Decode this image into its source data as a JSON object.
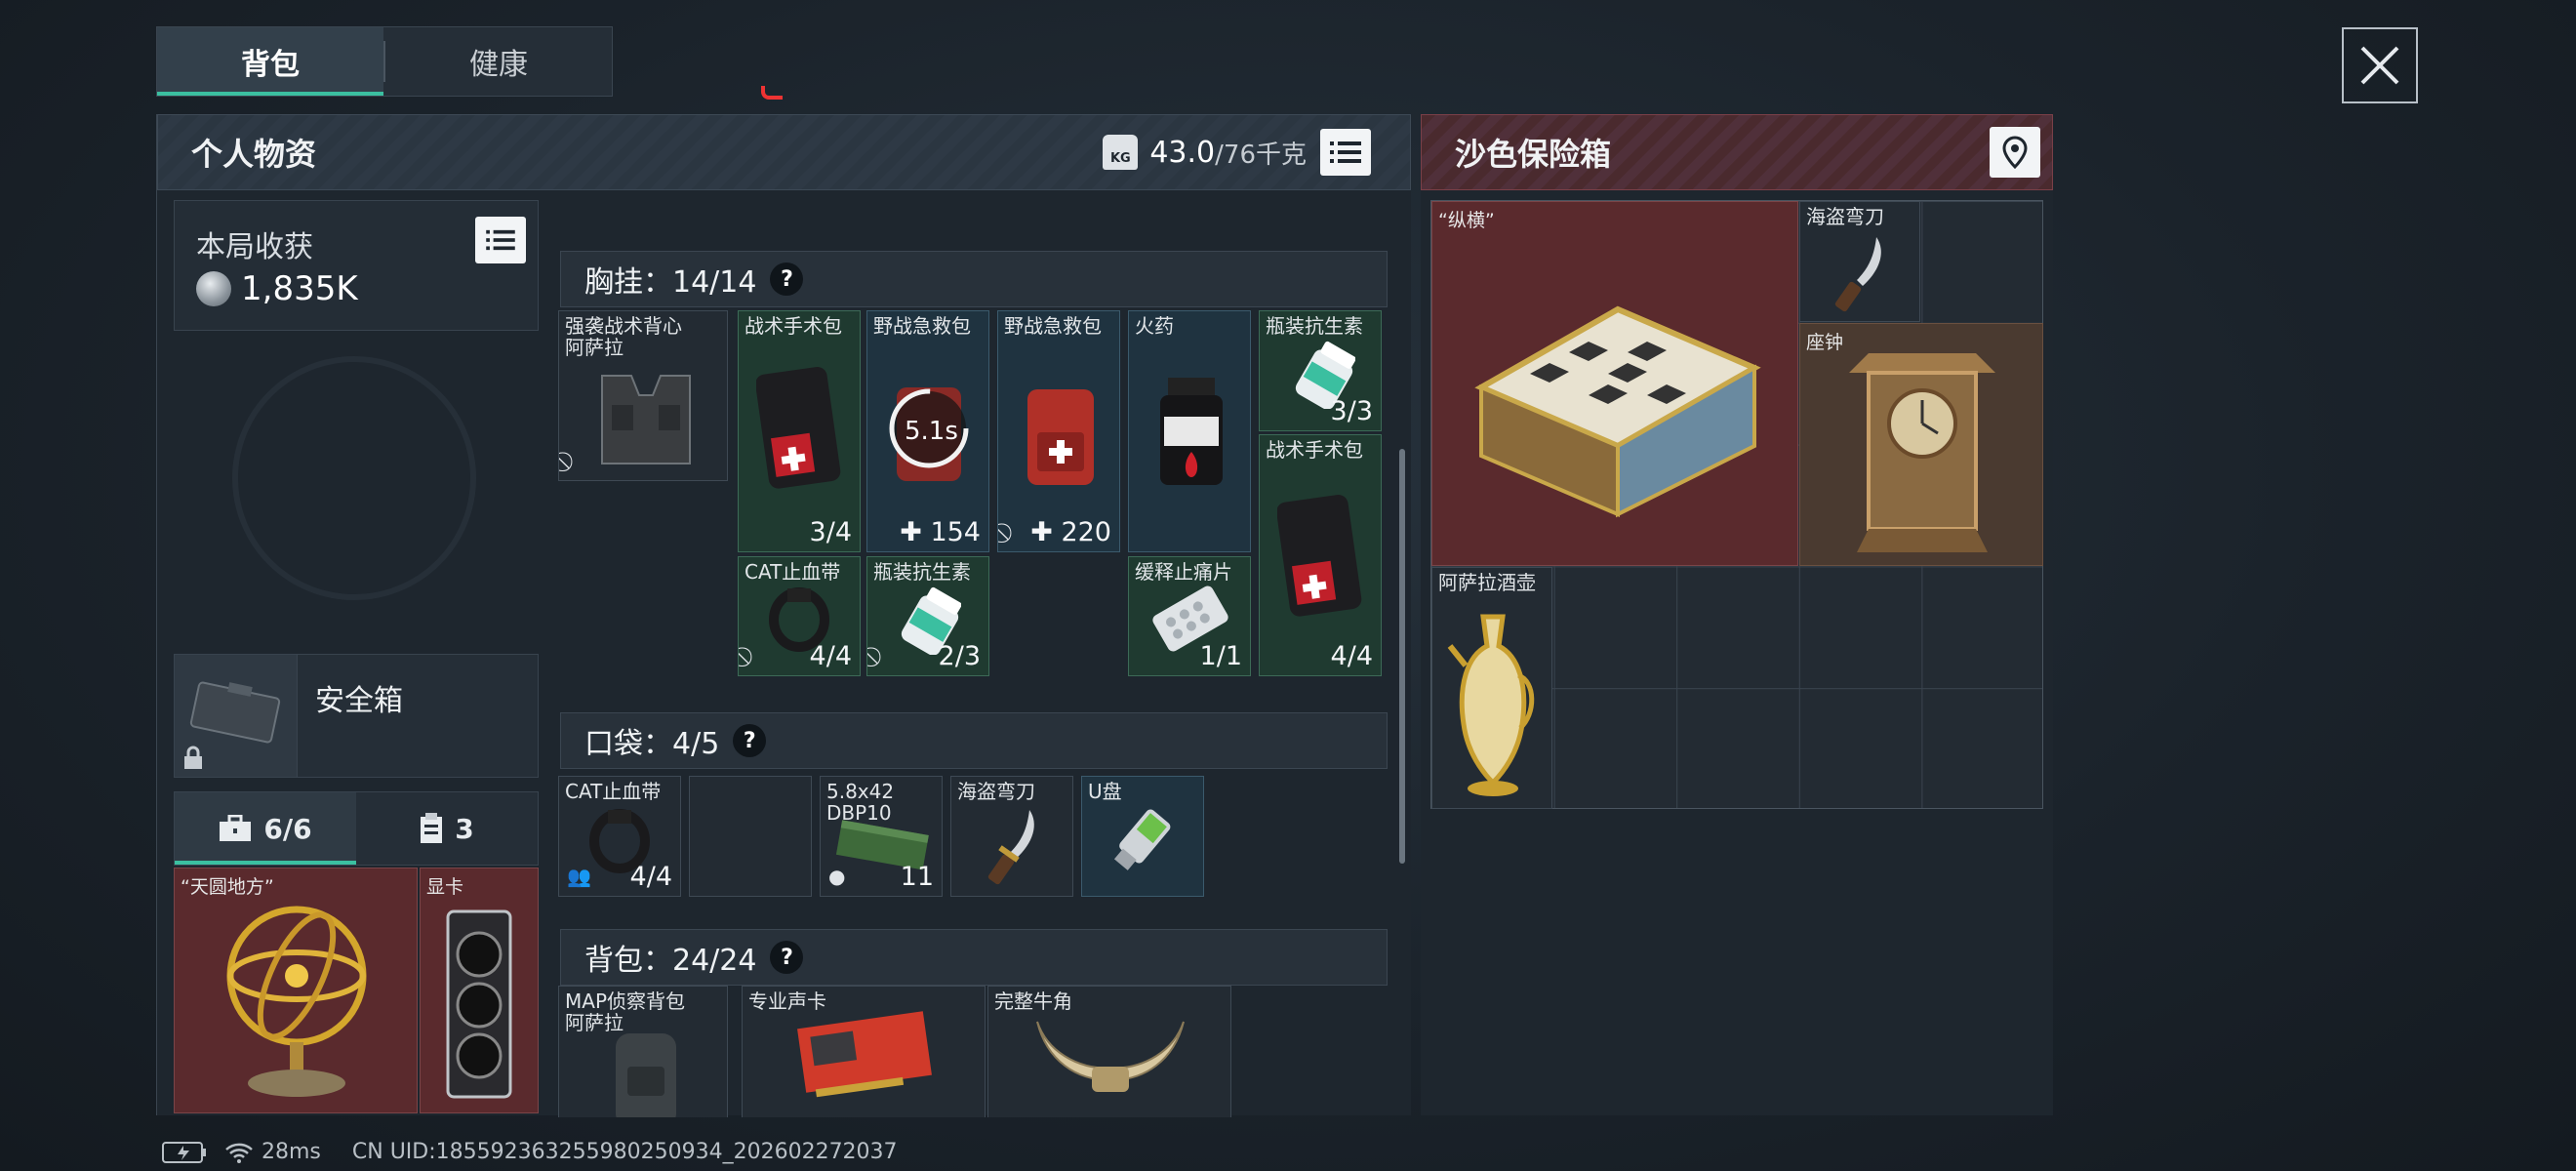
{
  "tabs": [
    {
      "label": "背包",
      "active": true
    },
    {
      "label": "健康",
      "active": false
    }
  ],
  "personal": {
    "title": "个人物资",
    "weight": "43.0",
    "weight_max": "/76千克"
  },
  "harvest": {
    "title": "本局收获",
    "value": "1,835K"
  },
  "safe_box": {
    "label": "安全箱"
  },
  "subtabs": [
    {
      "label": "6/6",
      "icon": "briefcase-icon"
    },
    {
      "label": "3",
      "icon": "clipboard-icon"
    }
  ],
  "safe_items": [
    {
      "name": "“天圆地方”"
    },
    {
      "name": "显卡"
    }
  ],
  "chest": {
    "title": "胸挂：14/14",
    "help": "?"
  },
  "chest_items": [
    {
      "name": "强袭战术背心\n阿萨拉",
      "count": ""
    },
    {
      "name": "战术手术包",
      "count": "3/4"
    },
    {
      "name": "野战急救包",
      "count": "154",
      "timer": "5.1s"
    },
    {
      "name": "野战急救包",
      "count": "220"
    },
    {
      "name": "火药",
      "count": ""
    },
    {
      "name": "瓶装抗生素",
      "count": "3/3"
    },
    {
      "name": "战术手术包",
      "count": "4/4"
    },
    {
      "name": "缓释止痛片",
      "count": "1/1"
    },
    {
      "name": "CAT止血带",
      "count": "4/4"
    },
    {
      "name": "瓶装抗生素",
      "count": "2/3"
    }
  ],
  "pocket": {
    "title": "口袋：4/5",
    "help": "?"
  },
  "pocket_items": [
    {
      "name": "CAT止血带",
      "count": "4/4"
    },
    {
      "name": "",
      "count": ""
    },
    {
      "name": "5.8x42\nDBP10",
      "count": "11"
    },
    {
      "name": "海盗弯刀",
      "count": ""
    },
    {
      "name": "U盘",
      "count": ""
    }
  ],
  "backpack": {
    "title": "背包：24/24",
    "help": "?"
  },
  "backpack_items": [
    {
      "name": "MAP侦察背包\n阿萨拉"
    },
    {
      "name": "专业声卡"
    },
    {
      "name": "完整牛角"
    }
  ],
  "container": {
    "title": "沙色保险箱"
  },
  "container_items": [
    {
      "name": "“纵横”"
    },
    {
      "name": "海盗弯刀"
    },
    {
      "name": "座钟"
    },
    {
      "name": "阿萨拉酒壶"
    }
  ],
  "status": {
    "ping": "28ms",
    "uid": "CN UID:18559236325598025093​4_202602272037"
  },
  "colors": {
    "accent": "#3bbfa0",
    "valuable": "#5a2a2d",
    "medical": "#1f3a30",
    "ammo": "#1f3340"
  }
}
